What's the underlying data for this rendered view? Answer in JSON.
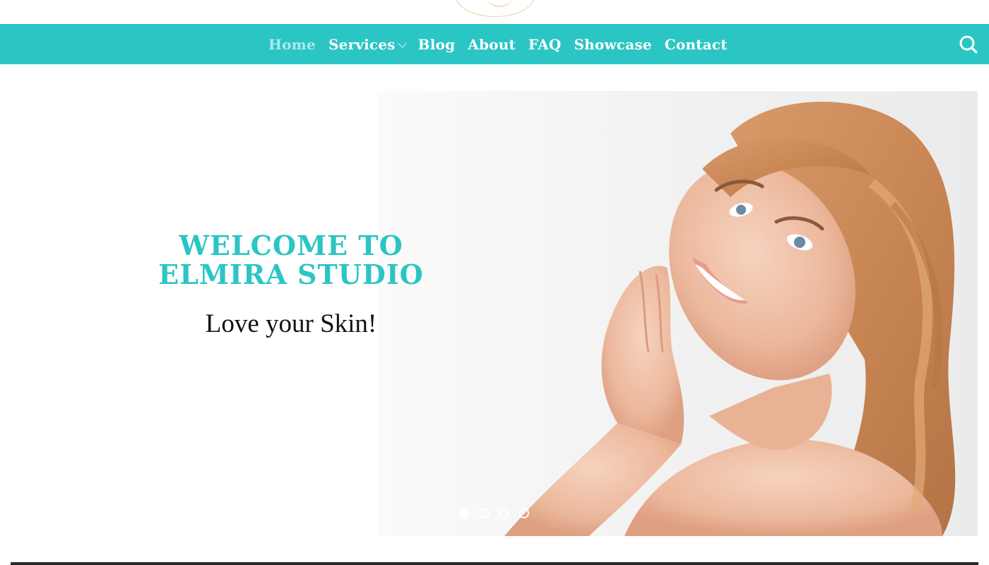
{
  "nav": {
    "items": [
      {
        "label": "Home",
        "active": true
      },
      {
        "label": "Services",
        "has_dropdown": true
      },
      {
        "label": "Blog"
      },
      {
        "label": "About"
      },
      {
        "label": "FAQ"
      },
      {
        "label": "Showcase"
      },
      {
        "label": "Contact"
      }
    ],
    "search_icon": "search-icon"
  },
  "hero": {
    "title_line1": "WELCOME TO",
    "title_line2": "ELMIRA STUDIO",
    "subtitle": "Love your Skin!",
    "slide_count": 4,
    "active_slide": 1
  },
  "colors": {
    "brand": "#2bc5c4",
    "nav_text": "#ffffff",
    "subtitle_text": "#111111"
  }
}
